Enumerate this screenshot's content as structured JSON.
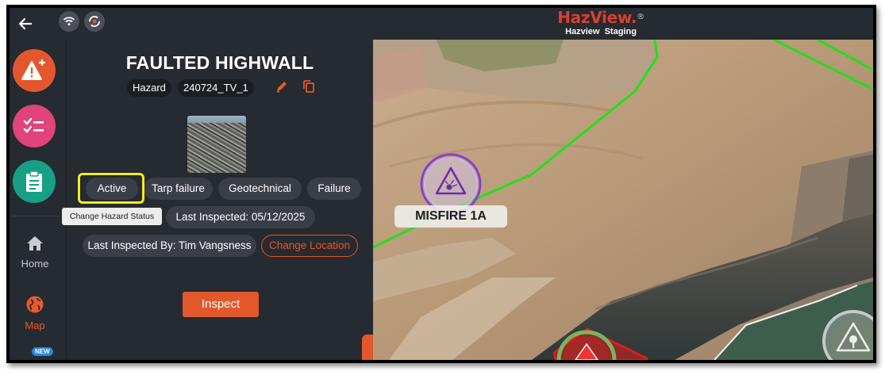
{
  "topbar": {
    "back_icon": "arrow-left-icon",
    "wifi_icon": "wifi-icon",
    "sync_icon": "sync-icon",
    "brand_name": "HazView.",
    "brand_mark": "®",
    "environment": "Hazview  Staging"
  },
  "sidebar": {
    "actions": [
      {
        "icon": "add-hazard-icon",
        "color": "#e4572e"
      },
      {
        "icon": "checklist-icon",
        "color": "#e0447a"
      },
      {
        "icon": "clipboard-icon",
        "color": "#17a085"
      }
    ],
    "items": [
      {
        "label": "Home",
        "icon": "home-icon",
        "active": false
      },
      {
        "label": "Map",
        "icon": "globe-icon",
        "active": true
      }
    ],
    "new_badge": "NEW"
  },
  "panel": {
    "title": "FAULTED HIGHWALL",
    "type_chip": "Hazard",
    "id_chip": "240724_TV_1",
    "status": "Active",
    "tags": [
      "Tarp failure",
      "Geotechnical",
      "Failure"
    ],
    "tooltip": "Change Hazard Status",
    "last_inspected": "Last Inspected: 05/12/2025",
    "last_inspected_by": "Last Inspected By: Tim Vangsness",
    "change_location": "Change Location",
    "inspect": "Inspect",
    "accent": "#e2582c",
    "highlight": "#f2ee1a"
  },
  "map": {
    "marker_label": "MISFIRE 1A",
    "boundary_color": "#22e01c",
    "marker_color": "#8a3fd1"
  }
}
